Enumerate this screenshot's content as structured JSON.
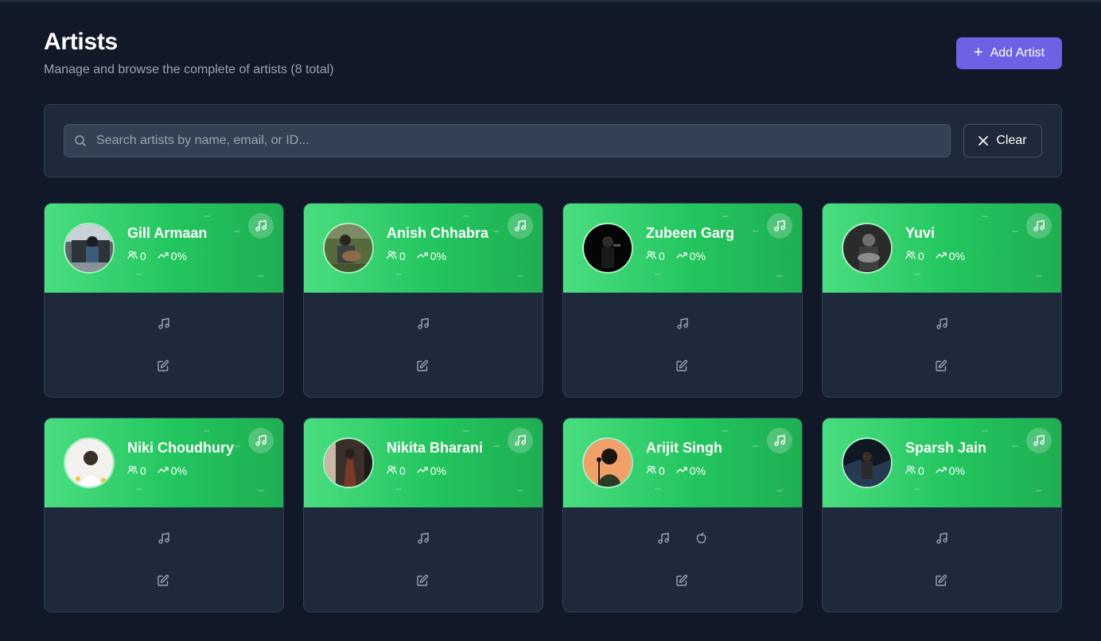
{
  "header": {
    "title": "Artists",
    "subtitle": "Manage and browse the complete of artists (8 total)",
    "add_button": "Add Artist"
  },
  "search": {
    "placeholder": "Search artists by name, email, or ID...",
    "value": "",
    "clear_label": "Clear"
  },
  "colors": {
    "background": "#111827",
    "panel": "#1e293b",
    "accent": "#6d62e6",
    "card_header_start": "#4ade80",
    "card_header_end": "#22c55e"
  },
  "artists": [
    {
      "name": "Gill Armaan",
      "followers": "0",
      "growth": "0%",
      "links": [
        "music-note-icon"
      ]
    },
    {
      "name": "Anish Chhabra",
      "followers": "0",
      "growth": "0%",
      "links": [
        "music-note-icon"
      ]
    },
    {
      "name": "Zubeen Garg",
      "followers": "0",
      "growth": "0%",
      "links": [
        "music-note-icon"
      ]
    },
    {
      "name": "Yuvi",
      "followers": "0",
      "growth": "0%",
      "links": [
        "music-note-icon"
      ]
    },
    {
      "name": "Niki Choudhury",
      "followers": "0",
      "growth": "0%",
      "links": [
        "music-note-icon"
      ]
    },
    {
      "name": "Nikita Bharani",
      "followers": "0",
      "growth": "0%",
      "links": [
        "music-note-icon"
      ]
    },
    {
      "name": "Arijit Singh",
      "followers": "0",
      "growth": "0%",
      "links": [
        "music-note-icon",
        "apple-icon"
      ]
    },
    {
      "name": "Sparsh Jain",
      "followers": "0",
      "growth": "0%",
      "links": [
        "music-note-icon"
      ]
    }
  ]
}
